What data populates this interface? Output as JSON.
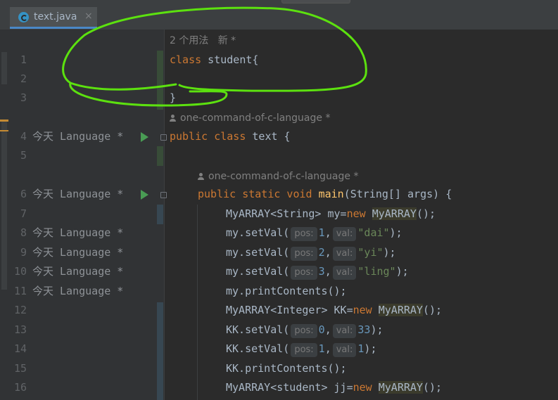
{
  "tab": {
    "filename": "text.java",
    "close_glyph": "×"
  },
  "usage_hint": "2 个用法   新 *",
  "author_hints": [
    "one-command-of-c-language *",
    "one-command-of-c-language *"
  ],
  "blame_label": "今天 Language *",
  "lines": [
    {
      "n": "1",
      "blame": ""
    },
    {
      "n": "2",
      "blame": ""
    },
    {
      "n": "3",
      "blame": ""
    },
    {
      "n": "4",
      "blame": "今天 Language *"
    },
    {
      "n": "5",
      "blame": ""
    },
    {
      "n": "6",
      "blame": "今天 Language *"
    },
    {
      "n": "7",
      "blame": ""
    },
    {
      "n": "8",
      "blame": "今天 Language *"
    },
    {
      "n": "9",
      "blame": "今天 Language *"
    },
    {
      "n": "10",
      "blame": "今天 Language *"
    },
    {
      "n": "11",
      "blame": "今天 Language *"
    },
    {
      "n": "12",
      "blame": ""
    },
    {
      "n": "13",
      "blame": ""
    },
    {
      "n": "14",
      "blame": ""
    },
    {
      "n": "15",
      "blame": ""
    },
    {
      "n": "16",
      "blame": ""
    }
  ],
  "code": {
    "l1_kw": "class",
    "l1_rest": " student{",
    "l3": "}",
    "l4_kw1": "public",
    "l4_kw2": "class",
    "l4_rest": " text {",
    "l6_kw": "public static void",
    "l6_fn": "main",
    "l6_rest": "(String[] args) {",
    "l7_a": "MyARRAY<String> my=",
    "l7_new": "new",
    "l7_cls": "MyARRAY",
    "l7_end": "();",
    "l8_a": "my.setVal(",
    "l8_h1": "pos:",
    "l8_v1": "1",
    "l8_comma": ",",
    "l8_h2": "val:",
    "l8_v2": "\"dai\"",
    "l8_end": ");",
    "l9_a": "my.setVal(",
    "l9_h1": "pos:",
    "l9_v1": "2",
    "l9_comma": ",",
    "l9_h2": "val:",
    "l9_v2": "\"yi\"",
    "l9_end": ");",
    "l10_a": "my.setVal(",
    "l10_h1": "pos:",
    "l10_v1": "3",
    "l10_comma": ",",
    "l10_h2": "val:",
    "l10_v2": "\"ling\"",
    "l10_end": ");",
    "l11": "my.printContents();",
    "l12_a": "MyARRAY<Integer> KK=",
    "l12_new": "new",
    "l12_cls": "MyARRAY",
    "l12_end": "();",
    "l13_a": "KK.setVal(",
    "l13_h1": "pos:",
    "l13_v1": "0",
    "l13_comma": ",",
    "l13_h2": "val:",
    "l13_v2": "33",
    "l13_end": ");",
    "l14_a": "KK.setVal(",
    "l14_h1": "pos:",
    "l14_v1": "1",
    "l14_comma": ",",
    "l14_h2": "val:",
    "l14_v2": "1",
    "l14_end": ");",
    "l15": "KK.printContents();",
    "l16_a": "MyARRAY<student> jj=",
    "l16_new": "new",
    "l16_cls": "MyARRAY",
    "l16_end": "();"
  },
  "colors": {
    "background": "#2b2b2b",
    "keyword": "#cc7832",
    "method": "#ffc66d",
    "string": "#6a8759",
    "number": "#6897bb",
    "annotation_circle": "#5ce10f",
    "run_icon": "#499c54",
    "tab_underline": "#4a88c7"
  }
}
